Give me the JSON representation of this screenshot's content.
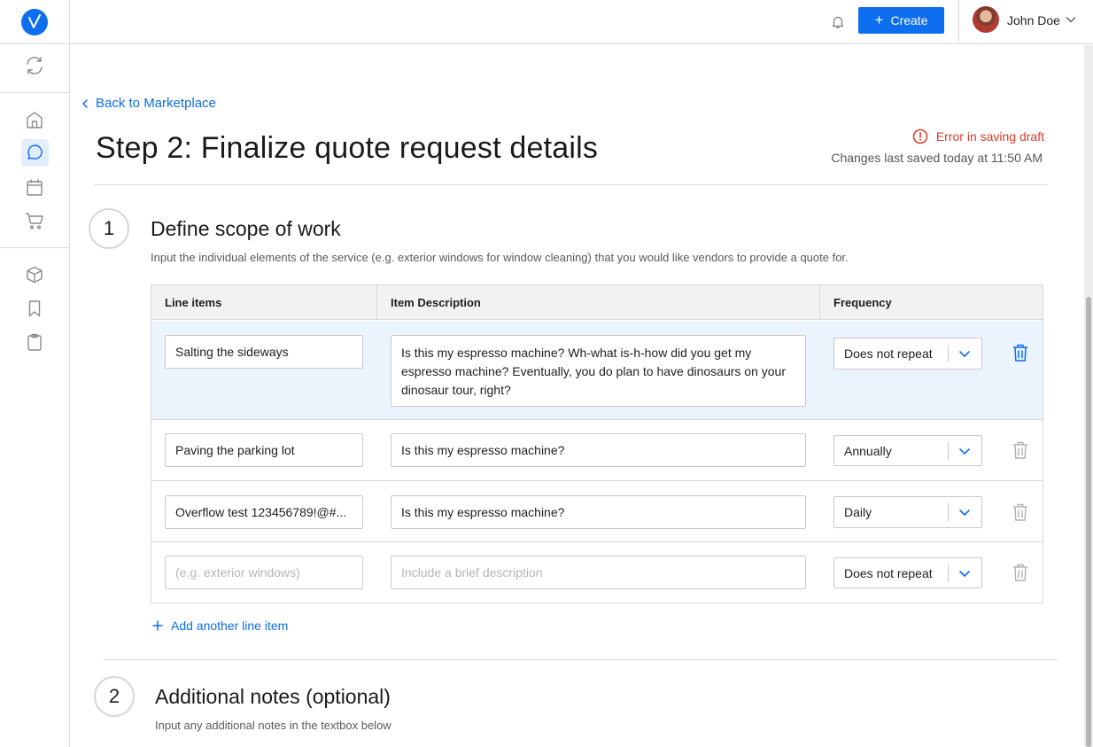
{
  "sidebar": {
    "logo_icon": "checkmark-logo",
    "icons": [
      "sync-icon",
      "home-icon",
      "chat-icon",
      "calendar-icon",
      "cart-icon",
      "box-icon",
      "bookmark-icon",
      "clipboard-icon"
    ],
    "active": "chat-icon"
  },
  "header": {
    "create_label": "Create",
    "user_name": "John Doe"
  },
  "main": {
    "back_label": "Back to Marketplace",
    "title": "Step 2: Finalize quote request details",
    "error_text": "Error in saving draft",
    "saved_text": "Changes last saved today at 11:50 AM",
    "section1": {
      "number": "1",
      "title": "Define scope of work",
      "description": "Input the individual elements of the service (e.g. exterior windows for window cleaning) that you would like vendors to provide a quote for."
    },
    "table": {
      "headers": [
        "Line items",
        "Item Description",
        "Frequency"
      ],
      "rows": [
        {
          "item": "Salting the sideways",
          "description": "Is this my espresso machine? Wh-what is-h-how did you get my espresso machine? Eventually, you do plan to have dinosaurs on your dinosaur tour, right?",
          "frequency": "Does not repeat"
        },
        {
          "item": "Paving the parking lot",
          "description": "Is this my espresso machine?",
          "frequency": "Annually"
        },
        {
          "item": "Overflow test 123456789!@#...",
          "description": "Is this my espresso machine?",
          "frequency": "Daily"
        },
        {
          "item_placeholder": "(e.g. exterior windows)",
          "description_placeholder": "Include a brief description",
          "frequency": "Does not repeat"
        }
      ]
    },
    "add_line_label": "Add another line item",
    "section2": {
      "number": "2",
      "title": "Additional notes (optional)",
      "description": "Input any additional notes in the textbox below"
    }
  },
  "colors": {
    "accent": "#0d6ef0",
    "error": "#d83a2a",
    "selected_row": "#ebf3fd"
  }
}
